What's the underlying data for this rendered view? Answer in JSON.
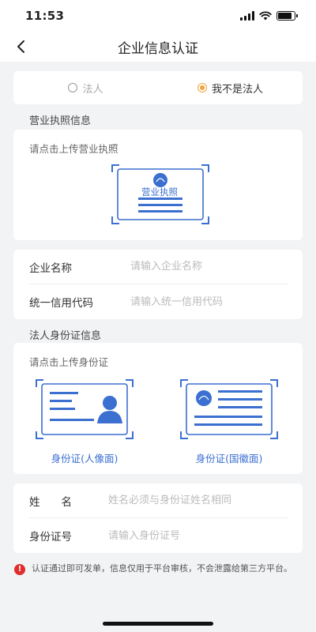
{
  "status_bar": {
    "time": "11:53",
    "battery_level": 0.85
  },
  "nav": {
    "title": "企业信息认证",
    "back_icon": "chevron-left-icon"
  },
  "role": {
    "options": [
      {
        "label": "法人",
        "selected": false
      },
      {
        "label": "我不是法人",
        "selected": true
      }
    ],
    "accent": "#f0a33a"
  },
  "license_section": {
    "title": "营业执照信息",
    "upload_hint": "请点击上传营业执照",
    "card_label": "营业执照"
  },
  "company_form": {
    "rows": [
      {
        "label": "企业名称",
        "placeholder": "请输入企业名称"
      },
      {
        "label": "统一信用代码",
        "placeholder": "请输入统一信用代码"
      }
    ]
  },
  "id_section": {
    "title": "法人身份证信息",
    "upload_hint": "请点击上传身份证",
    "front_caption": "身份证(人像面)",
    "back_caption": "身份证(国徽面)"
  },
  "person_form": {
    "rows": [
      {
        "label": "姓　　名",
        "placeholder": "姓名必须与身份证姓名相同"
      },
      {
        "label": "身份证号",
        "placeholder": "请输入身份证号"
      }
    ]
  },
  "notice": {
    "icon": "exclamation-icon",
    "text": "认证通过即可发单，信息仅用于平台审核，不会泄露给第三方平台。"
  },
  "colors": {
    "primary_blue": "#3b6fd0",
    "background": "#f2f3f5",
    "warning_red": "#e02e2e"
  }
}
